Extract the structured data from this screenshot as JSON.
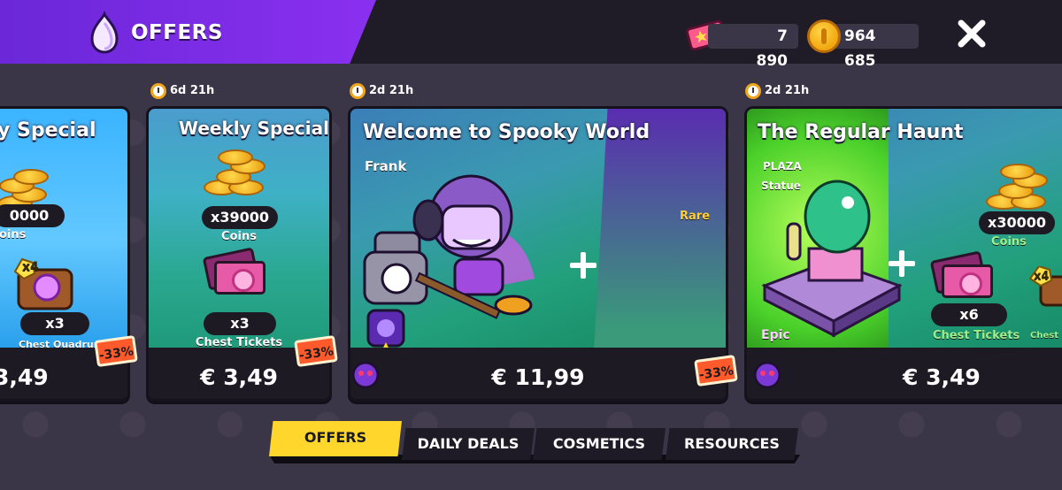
{
  "header": {
    "title": "OFFERS",
    "tickets": "7 890",
    "coins": "964 685"
  },
  "offers": [
    {
      "title": "y Special",
      "timer": "",
      "items": [
        {
          "qty": "0000",
          "label": "oins"
        },
        {
          "qty": "x3",
          "label": "Chest Quadrupler",
          "badge": "x4"
        }
      ],
      "discount": "-33%",
      "price": "3,49"
    },
    {
      "title": "Weekly Special",
      "timer": "6d 21h",
      "items": [
        {
          "qty": "x39000",
          "label": "Coins"
        },
        {
          "qty": "x3",
          "label": "Chest Tickets"
        }
      ],
      "discount": "-33%",
      "price": "€ 3,49"
    },
    {
      "title": "Welcome to Spooky World",
      "timer": "2d 21h",
      "brawler": "Frank",
      "rarity": "Rare",
      "discount": "-33%",
      "price": "€ 11,99"
    },
    {
      "title": "The Regular Haunt",
      "timer": "2d 21h",
      "statue_label_1": "PLAZA",
      "statue_label_2": "Statue",
      "rarity": "Epic",
      "items": [
        {
          "qty": "x30000",
          "label": "Coins"
        },
        {
          "qty": "x6",
          "label": "Chest Tickets"
        },
        {
          "qty": "x4",
          "label": "Chest Q"
        }
      ],
      "price": "€ 3,49"
    }
  ],
  "tabs": [
    {
      "label": "OFFERS",
      "active": true
    },
    {
      "label": "DAILY DEALS",
      "active": false
    },
    {
      "label": "COSMETICS",
      "active": false
    },
    {
      "label": "RESOURCES",
      "active": false
    }
  ],
  "colors": {
    "accent_purple": "#7a2ce6",
    "active_tab": "#ffd62b",
    "discount": "#ff5a2c",
    "coins_text": "#9df08a",
    "rare": "#ffcf3f"
  }
}
